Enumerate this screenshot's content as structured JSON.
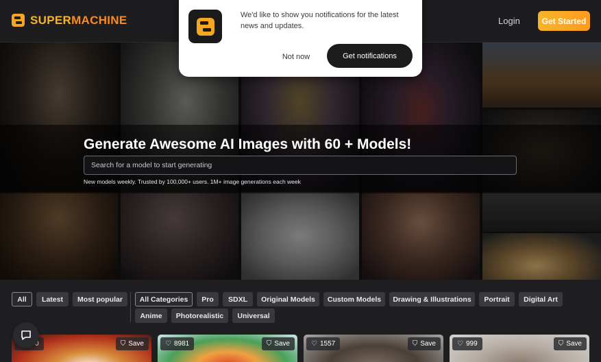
{
  "brand": {
    "name_part1": "SUPER",
    "name_part2": "MACHINE"
  },
  "header": {
    "login_label": "Login",
    "get_started_label": "Get Started"
  },
  "hero": {
    "title": "Generate Awesome AI Images with 60 + Models!",
    "search_placeholder": "Search for a model to start generating",
    "subtitle": "New models weekly. Trusted by 100,000+ users. 1M+ image generations each week"
  },
  "sort_filters": [
    "All",
    "Latest",
    "Most popular"
  ],
  "category_filters": [
    "All Categories",
    "Pro",
    "SDXL",
    "Original Models",
    "Custom Models",
    "Drawing & Illustrations",
    "Portrait",
    "Digital Art",
    "Anime",
    "Photorealistic",
    "Universal"
  ],
  "cards": [
    {
      "likes": "…0",
      "save_label": "Save"
    },
    {
      "likes": "8981",
      "save_label": "Save"
    },
    {
      "likes": "1557",
      "save_label": "Save"
    },
    {
      "likes": "999",
      "save_label": "Save"
    }
  ],
  "notification": {
    "message": "We'd like to show you notifications for the latest news and updates.",
    "decline_label": "Not now",
    "accept_label": "Get notifications"
  },
  "colors": {
    "brand_yellow": "#f5b623",
    "brand_orange": "#ff8a1f",
    "background": "#1b1b1e"
  }
}
